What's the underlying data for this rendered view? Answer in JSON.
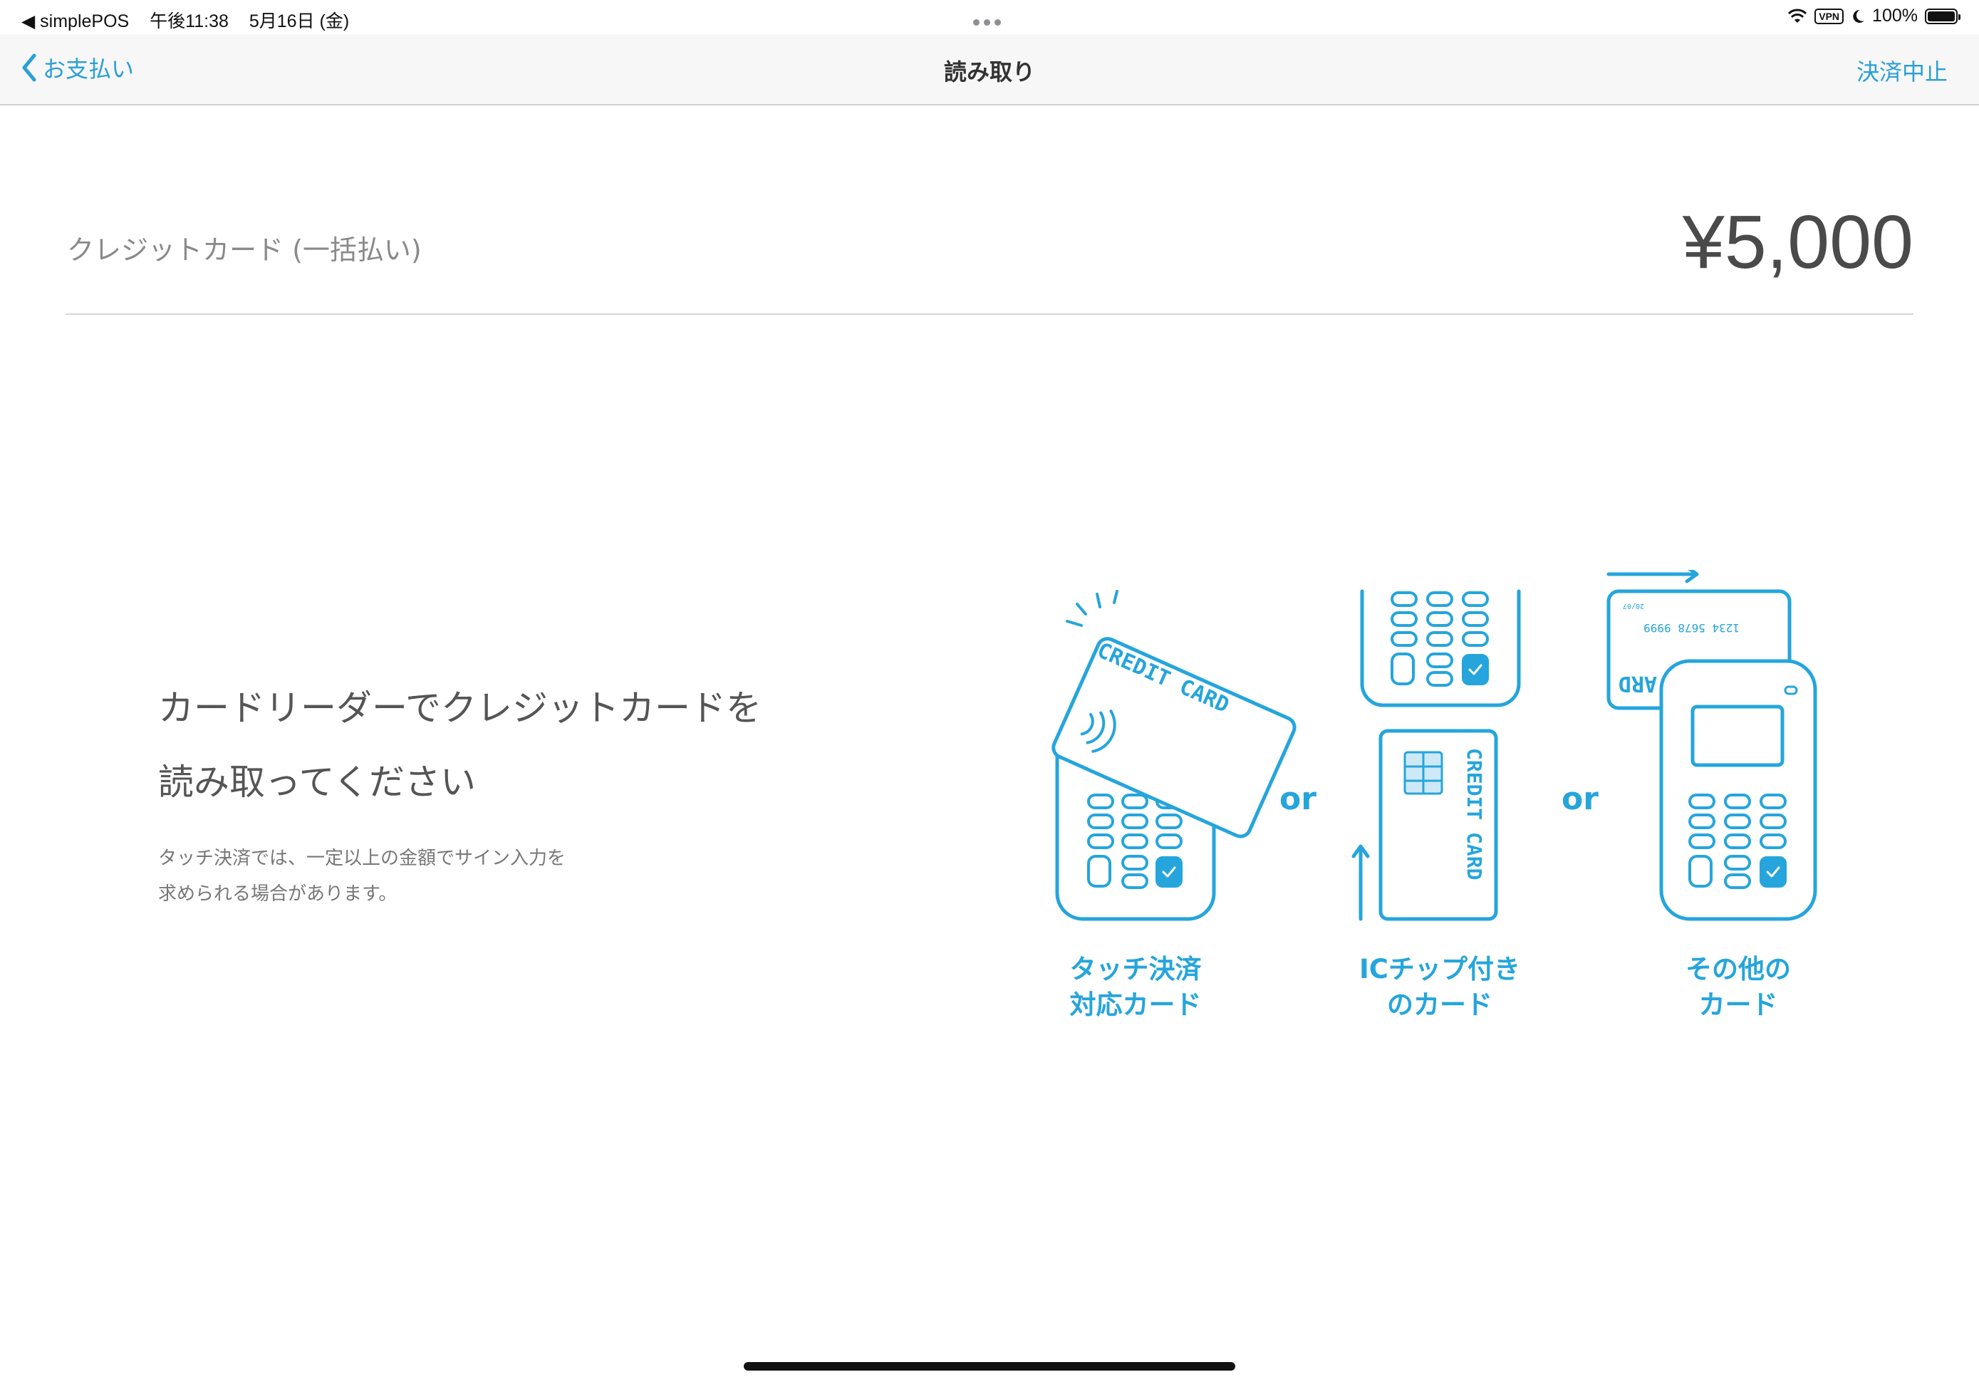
{
  "status_bar": {
    "back_app": "◀ simplePOS",
    "time": "午後11:38",
    "date": "5月16日 (金)",
    "vpn": "VPN",
    "battery": "100%"
  },
  "nav": {
    "back_label": "お支払い",
    "title": "読み取り",
    "cancel_label": "決済中止"
  },
  "payment": {
    "method": "クレジットカード (一括払い)",
    "amount": "¥5,000"
  },
  "instruction": {
    "line1": "カードリーダーでクレジットカードを",
    "line2": "読み取ってください"
  },
  "note": {
    "line1": "タッチ決済では、一定以上の金額でサイン入力を",
    "line2": "求められる場合があります。"
  },
  "illustration": {
    "card_text": "CREDIT CARD",
    "card_number": "1234 5678 9999",
    "card_expiry": "20/07",
    "card_partial": "ARD",
    "or_label": "or",
    "options": [
      {
        "line1": "タッチ決済",
        "line2": "対応カード"
      },
      {
        "line1": "ICチップ付き",
        "line2": "のカード"
      },
      {
        "line1": "その他の",
        "line2": "カード"
      }
    ],
    "accent_color": "#25a5dc"
  }
}
